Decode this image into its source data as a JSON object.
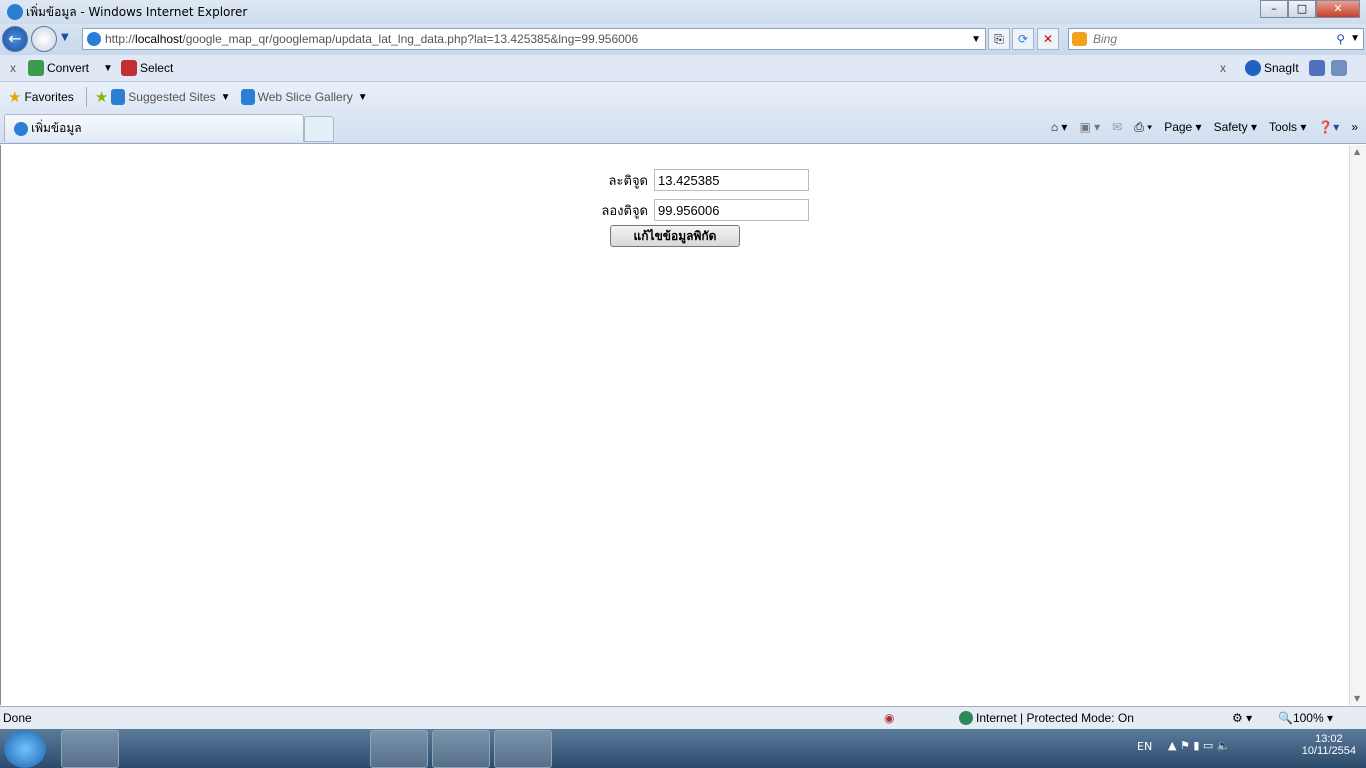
{
  "window": {
    "title": "เพิ่มข้อมูล - Windows Internet Explorer"
  },
  "address": {
    "prefix": "http://",
    "host": "localhost",
    "path": "/google_map_qr/googlemap/updata_lat_lng_data.php?lat=13.425385&lng=99.956006"
  },
  "search": {
    "placeholder": "Bing"
  },
  "toolbar1": {
    "convert": "Convert",
    "select": "Select",
    "snagit": "SnagIt"
  },
  "favorites": {
    "label": "Favorites",
    "items": [
      "Suggested Sites",
      "Web Slice Gallery"
    ]
  },
  "tab": {
    "label": "เพิ่มข้อมูล"
  },
  "commands": {
    "page": "Page",
    "safety": "Safety",
    "tools": "Tools"
  },
  "form": {
    "lat_label": "ละติจูด",
    "lat_value": "13.425385",
    "lng_label": "ลองติจูด",
    "lng_value": "99.956006",
    "submit": "แก้ไขข้อมูลพิกัด"
  },
  "status": {
    "text": "Done",
    "zone": "Internet | Protected Mode: On",
    "zoom": "100%"
  },
  "taskbar": {
    "lang": "EN",
    "time": "13:02",
    "date": "10/11/2554"
  }
}
